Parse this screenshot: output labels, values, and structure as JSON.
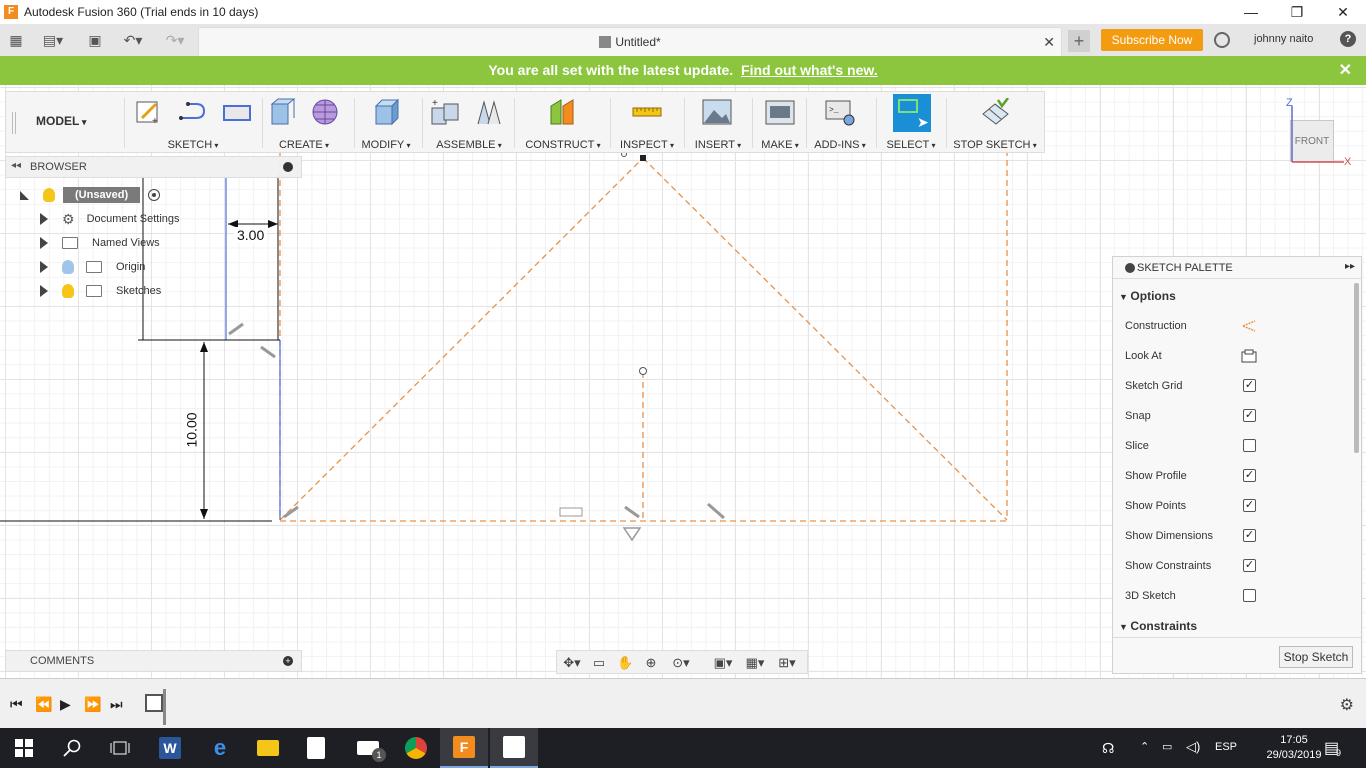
{
  "window": {
    "title": "Autodesk Fusion 360 (Trial ends in 10 days)",
    "minimize": "—",
    "restore": "❐",
    "close": "✕"
  },
  "tabbar": {
    "doc_title": "Untitled*",
    "doc_close": "✕",
    "new_tab": "+",
    "subscribe_label": "Subscribe Now",
    "user_name": "johnny naito",
    "help": "?"
  },
  "banner": {
    "message": "You are all set with the latest update.",
    "link": "Find out what's new.",
    "close": "✕",
    "color": "#8cc63f"
  },
  "toolbar": {
    "workspace": "MODEL",
    "groups": [
      "SKETCH",
      "CREATE",
      "MODIFY",
      "ASSEMBLE",
      "CONSTRUCT",
      "INSPECT",
      "INSERT",
      "MAKE",
      "ADD-INS",
      "SELECT",
      "STOP SKETCH"
    ],
    "select_color": "#1a8fd6"
  },
  "browser": {
    "title": "BROWSER",
    "root": "(Unsaved)",
    "items": [
      {
        "label": "Document Settings",
        "icon": "gear-icon"
      },
      {
        "label": "Named Views",
        "icon": "folder-icon"
      },
      {
        "label": "Origin",
        "icon": "folder-icon"
      },
      {
        "label": "Sketches",
        "icon": "folder-icon"
      }
    ]
  },
  "comments": {
    "title": "COMMENTS"
  },
  "viewcube": {
    "face": "FRONT",
    "z": "Z",
    "x": "X"
  },
  "sketch": {
    "dim_horizontal": "3.00",
    "dim_vertical": "10.00",
    "construction_color": "#e8924a",
    "line_color": "#4a6fd8"
  },
  "palette": {
    "title": "SKETCH PALETTE",
    "options_label": "Options",
    "constraints_label": "Constraints",
    "stop_label": "Stop Sketch",
    "rows": [
      {
        "label": "Construction",
        "type": "icon",
        "icon": "construction-icon"
      },
      {
        "label": "Look At",
        "type": "icon",
        "icon": "look-at-icon"
      },
      {
        "label": "Sketch Grid",
        "type": "check",
        "checked": true
      },
      {
        "label": "Snap",
        "type": "check",
        "checked": true
      },
      {
        "label": "Slice",
        "type": "check",
        "checked": false
      },
      {
        "label": "Show Profile",
        "type": "check",
        "checked": true
      },
      {
        "label": "Show Points",
        "type": "check",
        "checked": true
      },
      {
        "label": "Show Dimensions",
        "type": "check",
        "checked": true
      },
      {
        "label": "Show Constraints",
        "type": "check",
        "checked": true
      },
      {
        "label": "3D Sketch",
        "type": "check",
        "checked": false
      }
    ]
  },
  "taskbar": {
    "lang": "ESP",
    "time": "17:05",
    "date": "29/03/2019",
    "notif_count": "9",
    "mail_badge": "1"
  }
}
